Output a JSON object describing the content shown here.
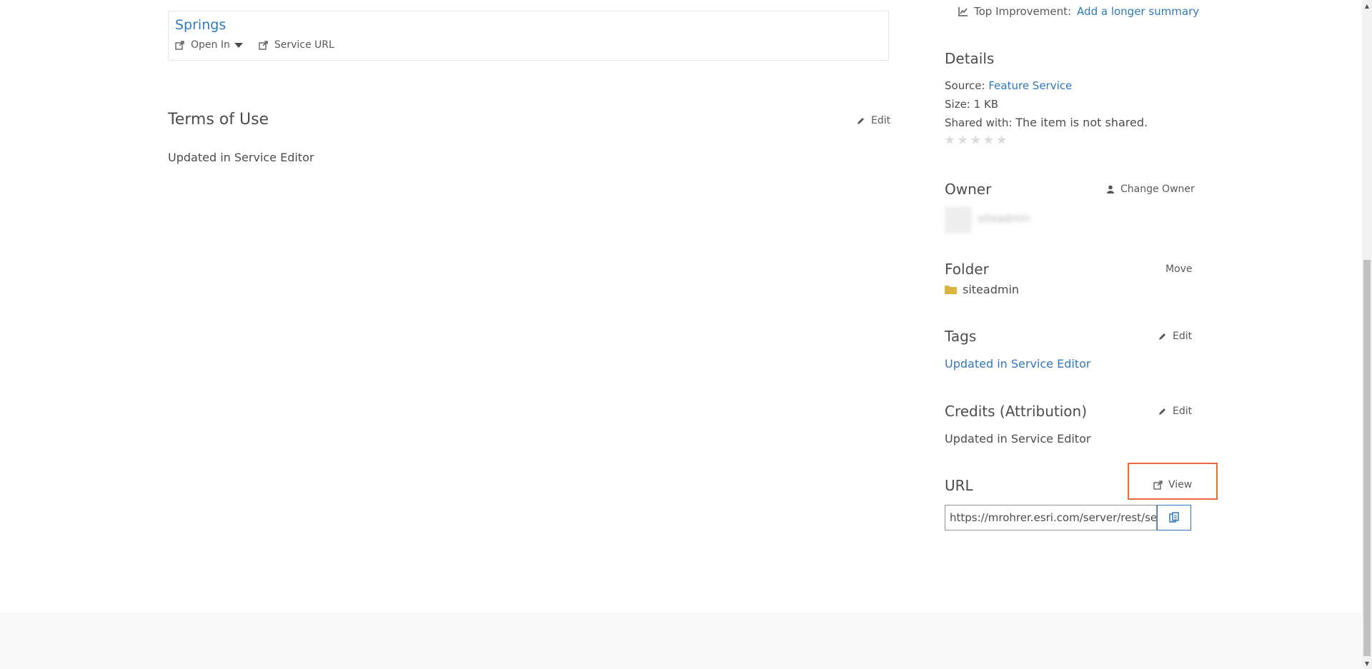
{
  "top_improvement": {
    "label": "Top Improvement:",
    "link": "Add a longer summary",
    "icon": "chart-icon"
  },
  "layer": {
    "title": "Springs",
    "open_in": "Open In",
    "service_url": "Service URL"
  },
  "terms": {
    "heading": "Terms of Use",
    "edit": "Edit",
    "text": "Updated in Service Editor"
  },
  "details": {
    "heading": "Details",
    "source_label": "Source:",
    "source_value": "Feature Service",
    "size_label": "Size:",
    "size_value": "1 KB",
    "shared_label": "Shared with:",
    "shared_value": "The item is not shared.",
    "stars": "★★★★★"
  },
  "owner": {
    "heading": "Owner",
    "change": "Change Owner",
    "name": "siteadmin"
  },
  "folder": {
    "heading": "Folder",
    "move": "Move",
    "name": "siteadmin"
  },
  "tags": {
    "heading": "Tags",
    "edit": "Edit",
    "value": "Updated in Service Editor"
  },
  "credits": {
    "heading": "Credits (Attribution)",
    "edit": "Edit",
    "value": "Updated in Service Editor"
  },
  "url": {
    "heading": "URL",
    "view": "View",
    "value": "https://mrohrer.esri.com/server/rest/services/Springs/FeatureServer"
  },
  "colors": {
    "link": "#2f78bd",
    "highlight": "#e9693f",
    "folder": "#d9b441"
  }
}
